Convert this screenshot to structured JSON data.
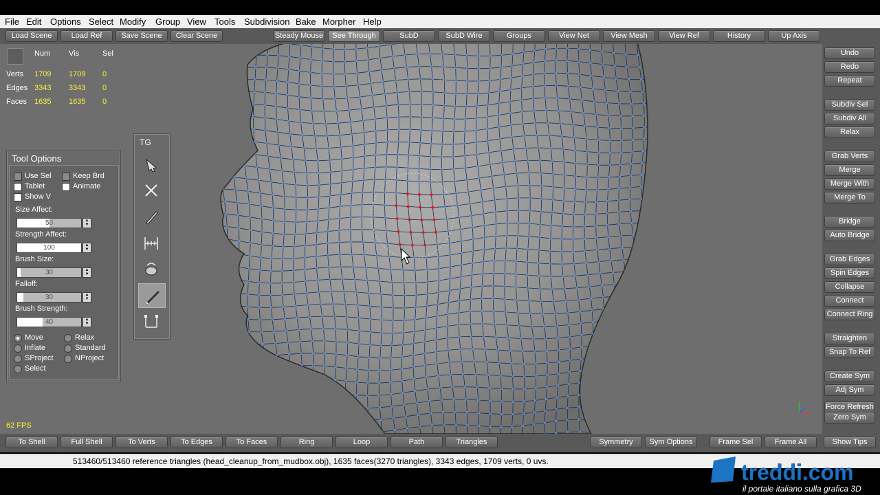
{
  "menu": [
    "File",
    "Edit",
    "Options",
    "Select",
    "Modify",
    "Group",
    "View",
    "Tools",
    "Subdivision",
    "Bake",
    "Morpher",
    "Help"
  ],
  "toolbar": [
    "Load Scene",
    "Load Ref",
    "Save Scene",
    "Clear Scene",
    "Steady Mouse",
    "See Through",
    "SubD",
    "SubD Wire",
    "Groups",
    "View Net",
    "View Mesh",
    "View Ref",
    "History",
    "Up Axis"
  ],
  "toolbar_active": "See Through",
  "stats": {
    "headers": [
      "Num",
      "Vis",
      "Sel"
    ],
    "rows": [
      {
        "label": "Verts",
        "num": "1709",
        "vis": "1709",
        "sel": "0"
      },
      {
        "label": "Edges",
        "num": "3343",
        "vis": "3343",
        "sel": "0"
      },
      {
        "label": "Faces",
        "num": "1635",
        "vis": "1635",
        "sel": "0"
      }
    ]
  },
  "fps": "62 FPS",
  "tool_options": {
    "title": "Tool Options",
    "checks": [
      {
        "label": "Use Sel",
        "checked": false
      },
      {
        "label": "Keep Brd",
        "checked": false
      },
      {
        "label": "Tablet",
        "checked": false
      },
      {
        "label": "Animate",
        "checked": false
      },
      {
        "label": "Show V",
        "checked": false
      }
    ],
    "fields": [
      {
        "label": "Size Affect:",
        "value": "50",
        "fill": 0.5
      },
      {
        "label": "Strength Affect:",
        "value": "100",
        "fill": 1.0
      },
      {
        "label": "Brush Size:",
        "value": "30",
        "fill": 0.05
      },
      {
        "label": "Falloff:",
        "value": "30",
        "fill": 0.1
      },
      {
        "label": "Brush Strength:",
        "value": "40",
        "fill": 0.4
      }
    ],
    "modes": [
      {
        "label": "Move",
        "on": true
      },
      {
        "label": "Relax",
        "on": false
      },
      {
        "label": "Inflate",
        "on": false
      },
      {
        "label": "Standard",
        "on": false
      },
      {
        "label": "SProject",
        "on": false
      },
      {
        "label": "NProject",
        "on": false
      },
      {
        "label": "Select",
        "on": false
      }
    ]
  },
  "tg": {
    "title": "TG",
    "tools": [
      "pen-add-icon",
      "cut-icon",
      "draw-icon",
      "measure-icon",
      "spin-icon",
      "brush-icon",
      "bridge-icon"
    ],
    "active_tool": "brush-icon"
  },
  "right_panel": [
    "Undo",
    "Redo",
    "Repeat",
    "Subdiv Sel",
    "Subdiv All",
    "Relax",
    "Grab Verts",
    "Merge",
    "Merge With",
    "Merge To",
    "Bridge",
    "Auto Bridge",
    "Grab Edges",
    "Spin Edges",
    "Collapse",
    "Connect",
    "Connect Ring",
    "Straighten",
    "Snap To Ref",
    "Create Sym",
    "Adj Sym",
    "Force Refresh",
    "Zero Sym"
  ],
  "bottom_bar": [
    "To Shell",
    "Full Shell",
    "To Verts",
    "To Edges",
    "To Faces",
    "Ring",
    "Loop",
    "Path",
    "Triangles",
    "Symmetry",
    "Sym Options",
    "Frame Sel",
    "Frame All",
    "Show Tips"
  ],
  "status": "513460/513460 reference triangles (head_cleanup_from_mudbox.obj), 1635 faces(3270 triangles), 3343 edges, 1709 verts, 0 uvs.",
  "watermark": {
    "brand": "treddi.com",
    "tagline": "il portale italiano sulla grafica 3D"
  },
  "colors": {
    "wire": "#1f2c43",
    "verts": "#4f8fe6",
    "selected": "#e3182c",
    "stats_value": "#ffef3a"
  }
}
